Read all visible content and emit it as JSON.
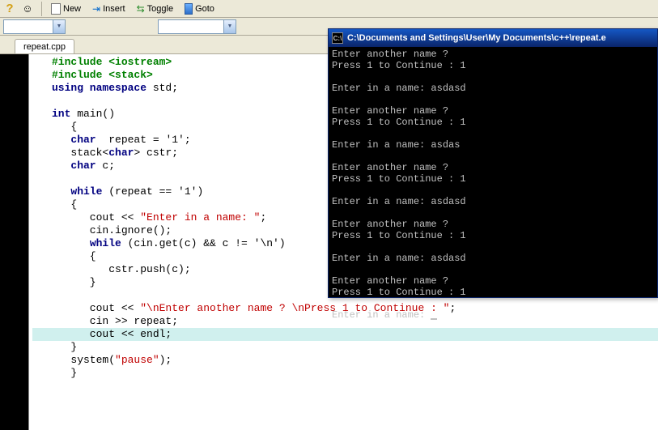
{
  "toolbar": {
    "new_label": "New",
    "insert_label": "Insert",
    "toggle_label": "Toggle",
    "goto_label": "Goto"
  },
  "tab": {
    "filename": "repeat.cpp"
  },
  "code": {
    "lines": [
      {
        "seg": [
          {
            "c": "kw-green",
            "t": "#include <iostream>"
          }
        ]
      },
      {
        "seg": [
          {
            "c": "kw-green",
            "t": "#include <stack>"
          }
        ]
      },
      {
        "seg": [
          {
            "c": "kw-blue",
            "t": "using namespace"
          },
          {
            "c": "blk",
            "t": " std;"
          }
        ]
      },
      {
        "seg": []
      },
      {
        "seg": [
          {
            "c": "kw-blue",
            "t": "int"
          },
          {
            "c": "blk",
            "t": " main()"
          }
        ]
      },
      {
        "seg": [
          {
            "c": "blk",
            "t": "   {"
          }
        ]
      },
      {
        "seg": [
          {
            "c": "blk",
            "t": "   "
          },
          {
            "c": "kw-blue",
            "t": "char"
          },
          {
            "c": "blk",
            "t": "  repeat = '1';"
          }
        ]
      },
      {
        "seg": [
          {
            "c": "blk",
            "t": "   stack<"
          },
          {
            "c": "kw-blue",
            "t": "char"
          },
          {
            "c": "blk",
            "t": "> cstr;"
          }
        ]
      },
      {
        "seg": [
          {
            "c": "blk",
            "t": "   "
          },
          {
            "c": "kw-blue",
            "t": "char"
          },
          {
            "c": "blk",
            "t": " c;"
          }
        ]
      },
      {
        "seg": []
      },
      {
        "seg": [
          {
            "c": "blk",
            "t": "   "
          },
          {
            "c": "kw-blue",
            "t": "while"
          },
          {
            "c": "blk",
            "t": " (repeat == '1')"
          }
        ]
      },
      {
        "seg": [
          {
            "c": "blk",
            "t": "   {"
          }
        ]
      },
      {
        "seg": [
          {
            "c": "blk",
            "t": "      cout << "
          },
          {
            "c": "str-red",
            "t": "\"Enter in a name: \""
          },
          {
            "c": "blk",
            "t": ";"
          }
        ]
      },
      {
        "seg": [
          {
            "c": "blk",
            "t": "      cin.ignore();"
          }
        ]
      },
      {
        "seg": [
          {
            "c": "blk",
            "t": "      "
          },
          {
            "c": "kw-blue",
            "t": "while"
          },
          {
            "c": "blk",
            "t": " (cin.get(c) && c != '\\n')"
          }
        ]
      },
      {
        "seg": [
          {
            "c": "blk",
            "t": "      {"
          }
        ]
      },
      {
        "seg": [
          {
            "c": "blk",
            "t": "         cstr.push(c);"
          }
        ]
      },
      {
        "seg": [
          {
            "c": "blk",
            "t": "      }"
          }
        ]
      },
      {
        "seg": []
      },
      {
        "seg": [
          {
            "c": "blk",
            "t": "      cout << "
          },
          {
            "c": "str-red",
            "t": "\"\\nEnter another name ? \\nPress 1 to Continue : \""
          },
          {
            "c": "blk",
            "t": ";"
          }
        ]
      },
      {
        "seg": [
          {
            "c": "blk",
            "t": "      cin >> repeat;"
          }
        ]
      },
      {
        "seg": [
          {
            "c": "blk",
            "t": "      cout << endl;"
          }
        ],
        "hl": true
      },
      {
        "seg": [
          {
            "c": "blk",
            "t": "   }"
          }
        ]
      },
      {
        "seg": [
          {
            "c": "blk",
            "t": "   system("
          },
          {
            "c": "str-red",
            "t": "\"pause\""
          },
          {
            "c": "blk",
            "t": ");"
          }
        ]
      },
      {
        "seg": [
          {
            "c": "blk",
            "t": "   }"
          }
        ]
      }
    ]
  },
  "console": {
    "title": "C:\\Documents and Settings\\User\\My Documents\\c++\\repeat.e",
    "output": "Enter another name ?\nPress 1 to Continue : 1\n\nEnter in a name: asdasd\n\nEnter another name ?\nPress 1 to Continue : 1\n\nEnter in a name: asdas\n\nEnter another name ?\nPress 1 to Continue : 1\n\nEnter in a name: asdasd\n\nEnter another name ?\nPress 1 to Continue : 1\n\nEnter in a name: asdasd\n\nEnter another name ?\nPress 1 to Continue : 1\n\nEnter in a name: "
  }
}
